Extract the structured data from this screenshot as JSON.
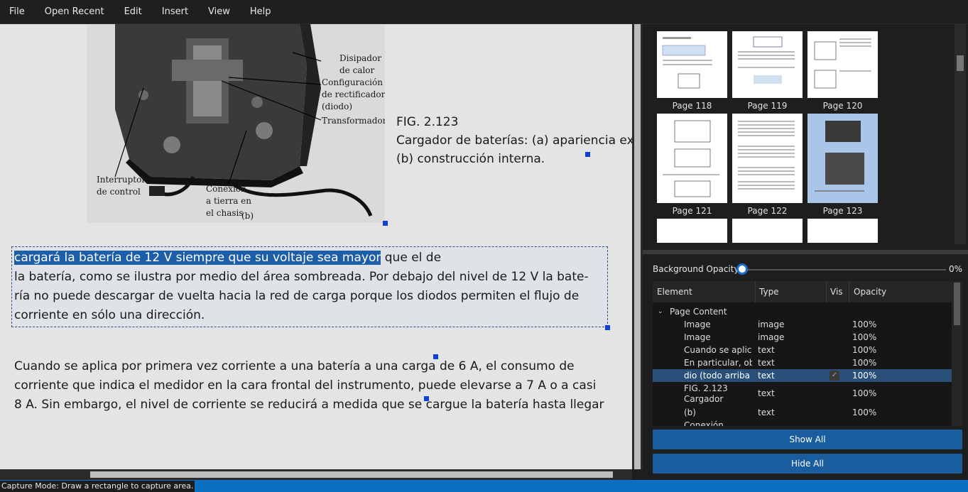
{
  "menu": [
    "File",
    "Open Recent",
    "Edit",
    "Insert",
    "View",
    "Help"
  ],
  "figure": {
    "labels": {
      "disipador": "Disipador\nde calor",
      "configuracion": "Configuración\nde rectificador\n(diodo)",
      "transformador": "Transformador",
      "interruptor": "Interruptor\nde control",
      "conexion": "Conexión\na tierra en\nel chasis",
      "part": "(b)"
    }
  },
  "caption": {
    "title": "FIG. 2.123",
    "line1": "Cargador de baterías: (a) apariencia ex",
    "line2": "(b) construcción interna."
  },
  "text_block": {
    "highlighted": "cargará la batería de 12 V siempre que su voltaje sea mayor",
    "line1_rest": " que el de",
    "line2": "la batería, como se ilustra por medio del área sombreada. Por debajo del nivel de 12 V la bate-",
    "line3": "ría no puede descargar de vuelta hacia la red de carga porque los diodos permiten el flujo de",
    "line4": "corriente en sólo una dirección."
  },
  "paragraph2": {
    "line1": "Cuando se aplica por primera vez corriente a una batería a una carga de 6 A, el consumo de",
    "line2": "corriente que indica el medidor en la cara frontal del instrumento, puede elevarse a 7 A o a casi",
    "line3": "8 A. Sin embargo, el nivel de corriente se reducirá a medida que se cargue la batería hasta llegar"
  },
  "thumbnails": [
    {
      "label": "Page 118"
    },
    {
      "label": "Page 119"
    },
    {
      "label": "Page 120"
    },
    {
      "label": "Page 121"
    },
    {
      "label": "Page 122"
    },
    {
      "label": "Page 123",
      "selected": true
    }
  ],
  "opacity": {
    "label": "Background Opacity:",
    "value": "0%",
    "level": 0
  },
  "layers": {
    "headers": {
      "element": "Element",
      "type": "Type",
      "vis": "Vis",
      "opacity": "Opacity"
    },
    "group": "Page Content",
    "rows": [
      {
        "element": "Image",
        "type": "image",
        "opacity": "100%"
      },
      {
        "element": "Image",
        "type": "image",
        "opacity": "100%"
      },
      {
        "element": "Cuando se aplic...",
        "type": "text",
        "opacity": "100%"
      },
      {
        "element": "En particular, ob...",
        "type": "text",
        "opacity": "100%"
      },
      {
        "element": "dio (todo arriba ...",
        "type": "text",
        "opacity": "100%",
        "selected": true
      },
      {
        "element": "FIG. 2.123\nCargador",
        "type": "text",
        "opacity": "100%"
      },
      {
        "element": "(b)",
        "type": "text",
        "opacity": "100%"
      },
      {
        "element": "Conexión",
        "type": "",
        "opacity": ""
      }
    ]
  },
  "buttons": {
    "show_all": "Show All",
    "hide_all": "Hide All"
  },
  "status": "Capture Mode: Draw a rectangle to capture area."
}
